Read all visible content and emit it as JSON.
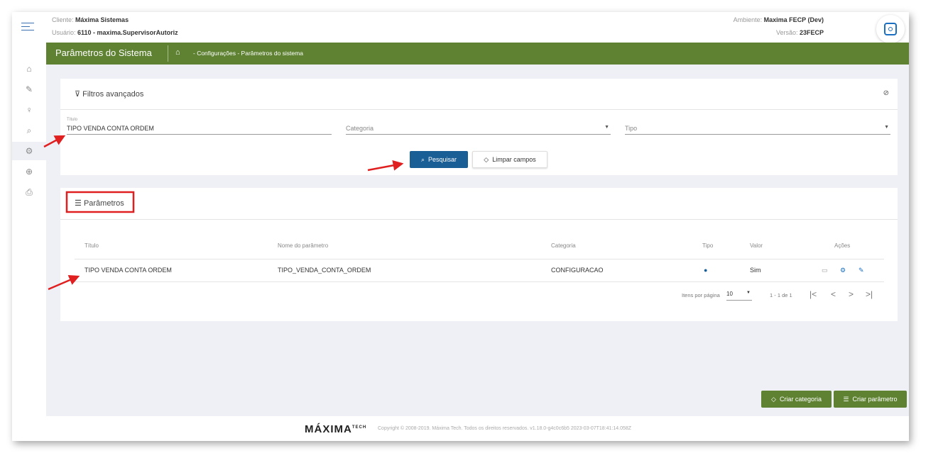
{
  "header": {
    "client_label": "Cliente:",
    "client": "Máxima Sistemas",
    "user_label": "Usuário:",
    "user": "6110 - maxima.SupervisorAutoriz",
    "env_label": "Ambiente:",
    "env": "Maxima FECP (Dev)",
    "version_label": "Versão:",
    "version": "23FECP",
    "corner": "⊡"
  },
  "titlebar": {
    "title": "Parâmetros do Sistema",
    "breadcrumb": "- Configurações - Parâmetros do sistema"
  },
  "filters": {
    "title": "Filtros avançados",
    "titulo_label": "Título",
    "titulo_value": "TIPO VENDA CONTA ORDEM",
    "categoria_placeholder": "Categoria",
    "tipo_placeholder": "Tipo",
    "search": "Pesquisar",
    "clear": "Limpar campos"
  },
  "params": {
    "title": "Parâmetros",
    "columns": [
      "Título",
      "Nome do parâmetro",
      "Categoria",
      "Tipo",
      "Valor",
      "Ações"
    ],
    "rows": [
      {
        "titulo": "TIPO VENDA CONTA ORDEM",
        "nome": "TIPO_VENDA_CONTA_ORDEM",
        "categoria": "CONFIGURACAO",
        "valor": "Sim"
      }
    ],
    "items_per_page_label": "Itens por página",
    "items_per_page": "10",
    "range": "1 - 1 de 1"
  },
  "actions": {
    "create_category": "Criar categoria",
    "create_param": "Criar parâmetro"
  },
  "footer": {
    "logo": "MÁXIMA TECH",
    "copyright": "Copyright © 2008-2019. Máxima Tech. Todos os direitos reservados. v1.18.0-g4c0c6b5 2023-03-07T18:41:14.058Z"
  },
  "colors": {
    "green": "#5e8232",
    "blue": "#1a5e96",
    "red": "#e02020"
  }
}
